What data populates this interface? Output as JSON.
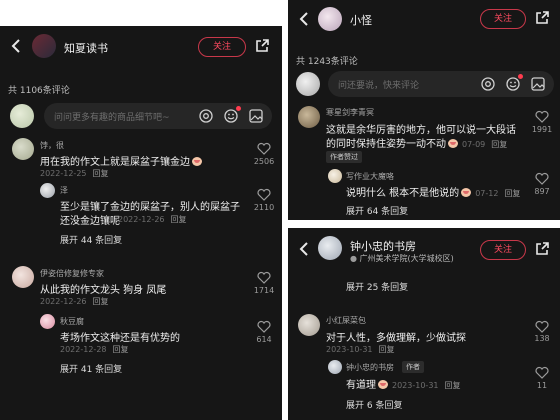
{
  "panel1": {
    "header": {
      "title": "知夏读书",
      "follow": "关注"
    },
    "count": "共 1106条评论",
    "input_placeholder": "问问更多有趣的商品细节吧~",
    "comments": [
      {
        "name": "饽，很",
        "text": "用在我的作文上就是屎盆子镶金边",
        "date": "2022-12-25",
        "reply": "回复",
        "likes": "2506"
      },
      {
        "name": "泽",
        "text": "至少是镶了金边的屎盆子，别人的屎盆子",
        "text2": "还没金边镶呢",
        "date": "2022-12-26",
        "reply": "回复",
        "likes": "2110"
      },
      {
        "name": "伊姿倍修复修专家",
        "text": "从此我的作文龙头  狗身    凤尾",
        "date": "2022-12-26",
        "reply": "回复",
        "likes": "1714"
      },
      {
        "name": "秋豆腐",
        "text": "考场作文这种还是有优势的",
        "date": "2022-12-28",
        "reply": "回复",
        "likes": "614"
      }
    ],
    "expand1": "展开 44 条回复",
    "expand2": "展开 41 条回复"
  },
  "panel2": {
    "header": {
      "title": "小怪",
      "follow": "关注"
    },
    "count": "共 1243条评论",
    "input_placeholder": "问还要说，快来评论",
    "comments": [
      {
        "name": "寒星剑李青冥",
        "text": "这就是余华厉害的地方，他可以说一大段话",
        "text2": "的同时保持住姿势一动不动",
        "date": "07-09",
        "reply": "回复",
        "likes": "1991",
        "badge": "作者赞过"
      },
      {
        "name": "写作业大魔咯",
        "text": "说明什么 根本不是他说的",
        "date": "07-12",
        "reply": "回复",
        "likes": "897"
      }
    ],
    "expand": "展开 64 条回复"
  },
  "panel3": {
    "header": {
      "title": "钟小忠的书房",
      "subtitle": "广州美术学院(大学城校区)",
      "follow": "关注"
    },
    "expand_top": "展开 25 条回复",
    "comments": [
      {
        "name": "小红屎菜包",
        "text": "对于人性，多做理解，少做试探",
        "date": "2023-10-31",
        "reply": "回复",
        "likes": "138"
      },
      {
        "name": "钟小忠的书房",
        "author_badge": "作者",
        "text": "有道理",
        "date": "2023-10-31",
        "reply": "回复",
        "likes": "11"
      }
    ],
    "expand": "展开 6 条回复"
  },
  "colors": {
    "panel_bg": "#161616",
    "accent": "#ff4a60",
    "page_bg": "#ffffff"
  },
  "icons": [
    "back-arrow-icon",
    "share-icon",
    "at-icon",
    "emoji-icon",
    "image-icon",
    "heart-icon"
  ]
}
